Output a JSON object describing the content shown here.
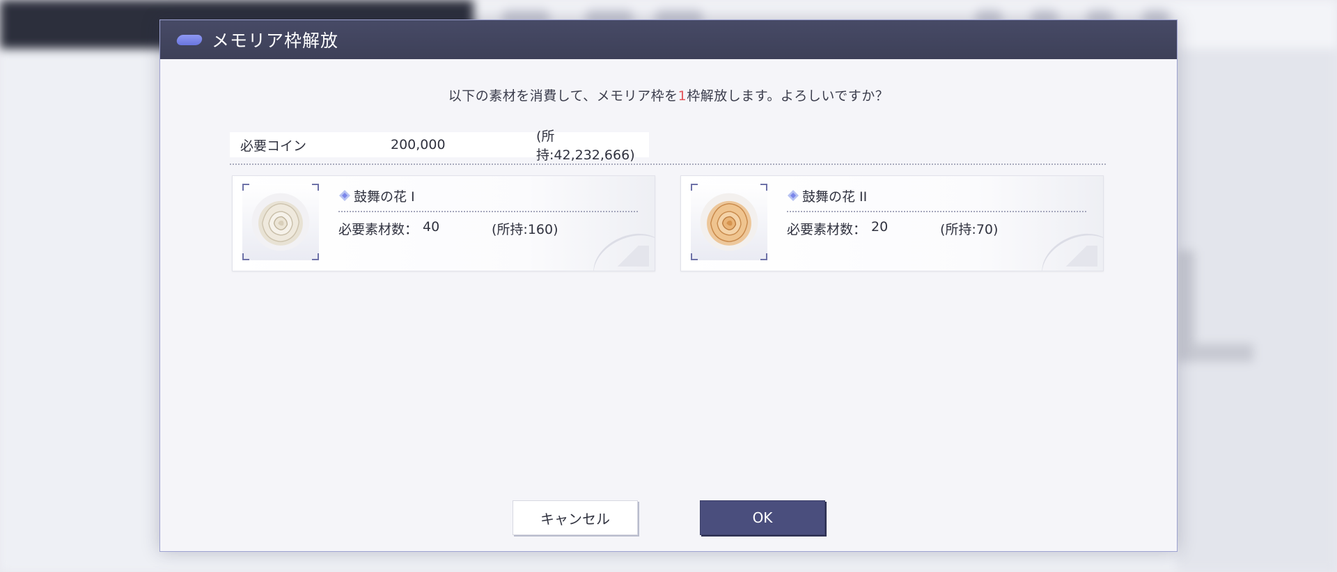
{
  "dialog": {
    "title": "メモリア枠解放",
    "message_before": "以下の素材を消費して、メモリア枠を",
    "message_number": "1",
    "message_after": "枠解放します。よろしいですか？"
  },
  "coin": {
    "label": "必要コイン",
    "value": "200,000",
    "owned": "(所持:42,232,666)"
  },
  "materials": [
    {
      "name": "鼓舞の花 I",
      "required_label": "必要素材数：",
      "required_value": "40",
      "owned": "(所持:160)",
      "icon": "white-rose-icon",
      "color": "#e9e3d6"
    },
    {
      "name": "鼓舞の花 II",
      "required_label": "必要素材数：",
      "required_value": "20",
      "owned": "(所持:70)",
      "icon": "orange-rose-icon",
      "color": "#e6ad6a"
    }
  ],
  "buttons": {
    "cancel": "キャンセル",
    "ok": "OK"
  },
  "colors": {
    "header_bg": "#434660",
    "accent": "#7b86ea",
    "highlight_number": "#e2545a",
    "ok_button": "#4a4e7d"
  }
}
